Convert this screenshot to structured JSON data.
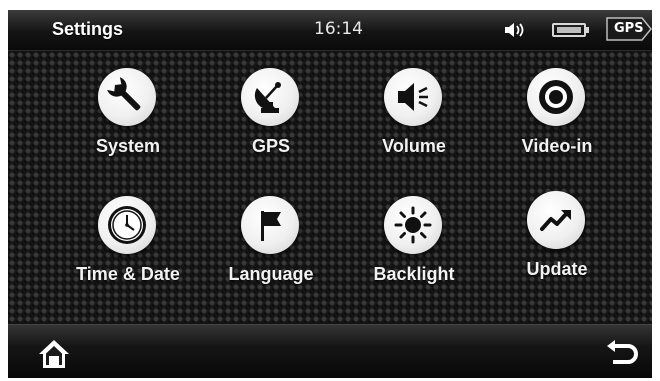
{
  "header": {
    "title": "Settings",
    "time": "16:14",
    "volume_icon": "speaker-icon",
    "battery_icon": "battery-icon",
    "gps_label": "GPS"
  },
  "tiles": [
    {
      "label": "System",
      "icon": "wrench-icon"
    },
    {
      "label": "GPS",
      "icon": "satellite-dish-icon"
    },
    {
      "label": "Volume",
      "icon": "speaker-icon"
    },
    {
      "label": "Video-in",
      "icon": "video-target-icon"
    },
    {
      "label": "Time & Date",
      "icon": "clock-icon"
    },
    {
      "label": "Language",
      "icon": "flag-icon"
    },
    {
      "label": "Backlight",
      "icon": "sun-icon"
    },
    {
      "label": "Update",
      "icon": "trend-arrow-icon"
    }
  ],
  "footer": {
    "home_icon": "home-icon",
    "back_icon": "back-arrow-icon"
  }
}
